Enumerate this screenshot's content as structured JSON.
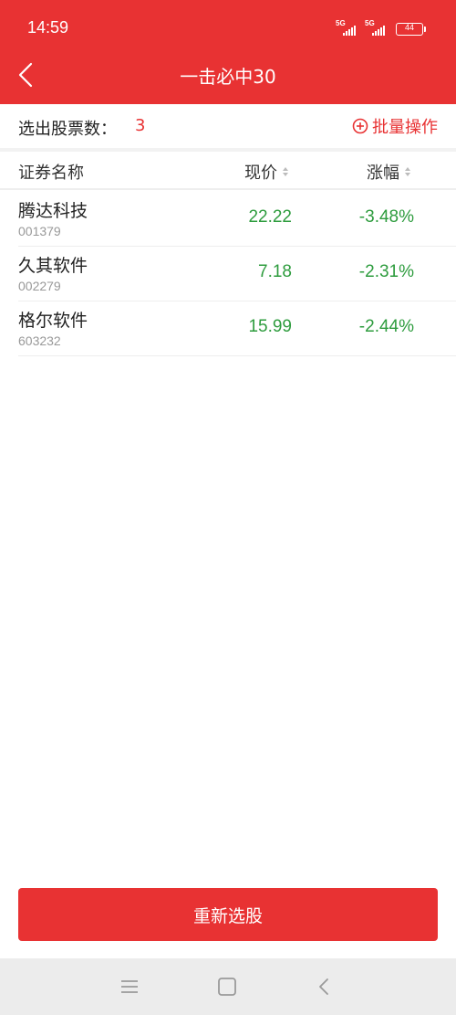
{
  "status_bar": {
    "time": "14:59",
    "signal_1_label": "5G",
    "signal_2_label": "5G",
    "battery_level": "44"
  },
  "header": {
    "title": "一击必中30"
  },
  "summary": {
    "count_label": "选出股票数：",
    "count_value": "3",
    "batch_label": "批量操作"
  },
  "table": {
    "columns": {
      "name": "证券名称",
      "price": "现价",
      "change": "涨幅"
    },
    "rows": [
      {
        "name": "腾达科技",
        "code": "001379",
        "price": "22.22",
        "change": "-3.48%"
      },
      {
        "name": "久其软件",
        "code": "002279",
        "price": "7.18",
        "change": "-2.31%"
      },
      {
        "name": "格尔软件",
        "code": "603232",
        "price": "15.99",
        "change": "-2.44%"
      }
    ]
  },
  "footer": {
    "reselect_label": "重新选股"
  },
  "colors": {
    "brand": "#e83233",
    "down": "#2e9c3e"
  }
}
